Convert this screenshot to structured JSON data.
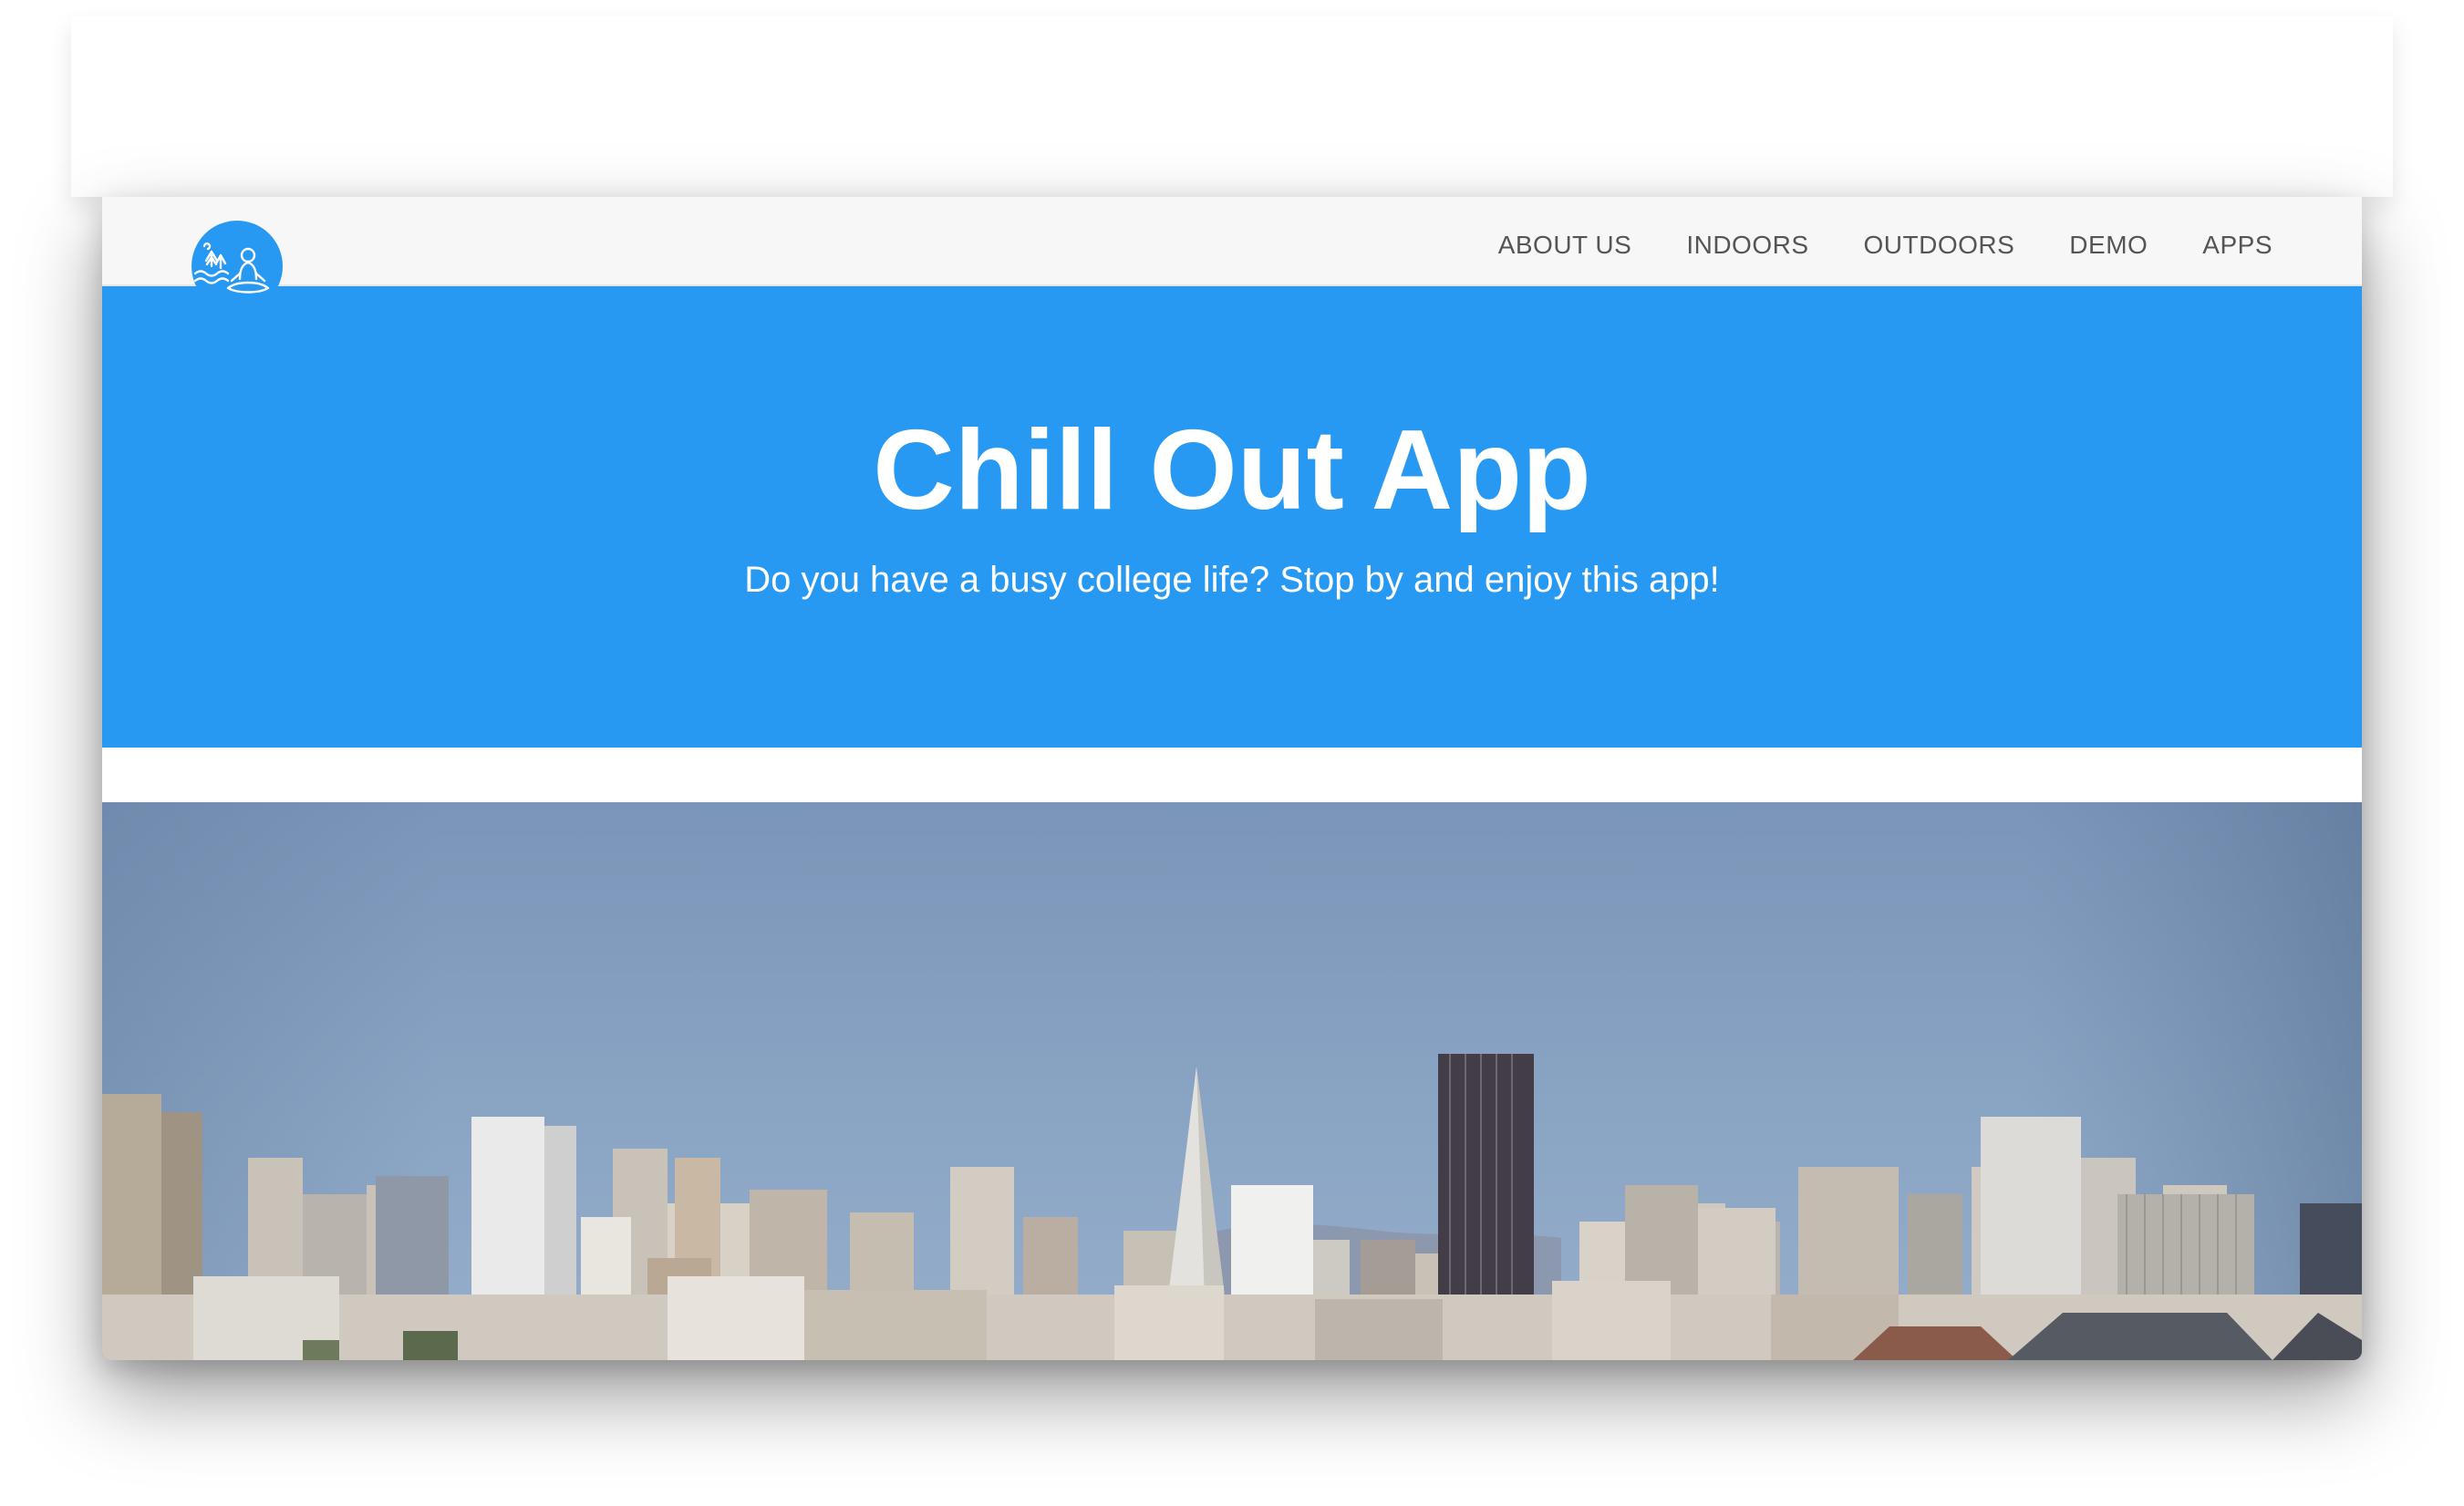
{
  "nav": {
    "logo_icon": "meditation-nature-logo-icon",
    "items": [
      {
        "label": "ABOUT US"
      },
      {
        "label": "INDOORS"
      },
      {
        "label": "OUTDOORS"
      },
      {
        "label": "DEMO"
      },
      {
        "label": "APPS"
      }
    ]
  },
  "hero": {
    "title": "Chill Out App",
    "subtitle": "Do you have a busy college life? Stop by and enjoy this app!"
  },
  "banner": {
    "image_subject": "city-skyline-photo"
  },
  "colors": {
    "accent": "#2899f3",
    "navbar_bg": "#f7f7f7",
    "nav_text": "#555555",
    "hero_text": "#ffffff"
  }
}
